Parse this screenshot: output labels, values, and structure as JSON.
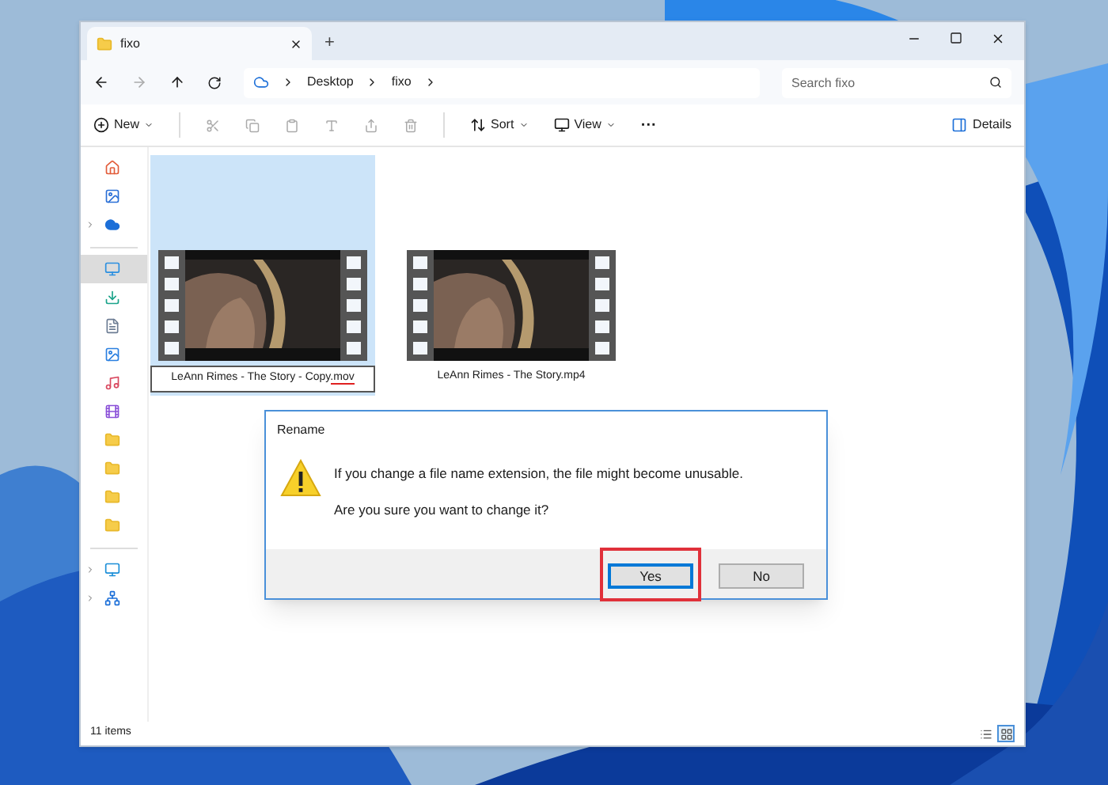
{
  "tab": {
    "title": "fixo",
    "new_tab": "+"
  },
  "address": {
    "crumbs": [
      "Desktop",
      "fixo"
    ],
    "search_placeholder": "Search fixo"
  },
  "toolbar": {
    "new": "New",
    "sort": "Sort",
    "view": "View",
    "more": "···",
    "details": "Details"
  },
  "sidebar": [
    {
      "kind": "home",
      "selected": false,
      "expandable": false
    },
    {
      "kind": "gallery",
      "selected": false,
      "expandable": false
    },
    {
      "kind": "cloud",
      "selected": false,
      "expandable": true
    },
    {
      "kind": "divider"
    },
    {
      "kind": "desktop",
      "selected": true,
      "expandable": false
    },
    {
      "kind": "download",
      "selected": false,
      "expandable": false
    },
    {
      "kind": "document",
      "selected": false,
      "expandable": false
    },
    {
      "kind": "pictures",
      "selected": false,
      "expandable": false
    },
    {
      "kind": "music",
      "selected": false,
      "expandable": false
    },
    {
      "kind": "videos",
      "selected": false,
      "expandable": false
    },
    {
      "kind": "folder",
      "selected": false,
      "expandable": false
    },
    {
      "kind": "folder",
      "selected": false,
      "expandable": false
    },
    {
      "kind": "folder",
      "selected": false,
      "expandable": false
    },
    {
      "kind": "folder",
      "selected": false,
      "expandable": false
    },
    {
      "kind": "divider"
    },
    {
      "kind": "pc",
      "selected": false,
      "expandable": true
    },
    {
      "kind": "network",
      "selected": false,
      "expandable": true
    }
  ],
  "files": [
    {
      "name": "LeAnn Rimes - The Story - Copy",
      "marked": ".mov",
      "selected": true,
      "editing": true
    },
    {
      "name": "LeAnn Rimes - The Story.mp4",
      "selected": false,
      "editing": false
    }
  ],
  "dialog": {
    "title": "Rename",
    "message": "If you change a file name extension, the file might become unusable.",
    "question": "Are you sure you want to change it?",
    "buttons": [
      {
        "label": "Yes",
        "default": true,
        "highlighted": true
      },
      {
        "label": "No",
        "default": false,
        "highlighted": false
      }
    ]
  },
  "status_bar": {
    "count": "11 items",
    "views": [
      {
        "kind": "details",
        "selected": false
      },
      {
        "kind": "tiles",
        "selected": true
      }
    ]
  }
}
